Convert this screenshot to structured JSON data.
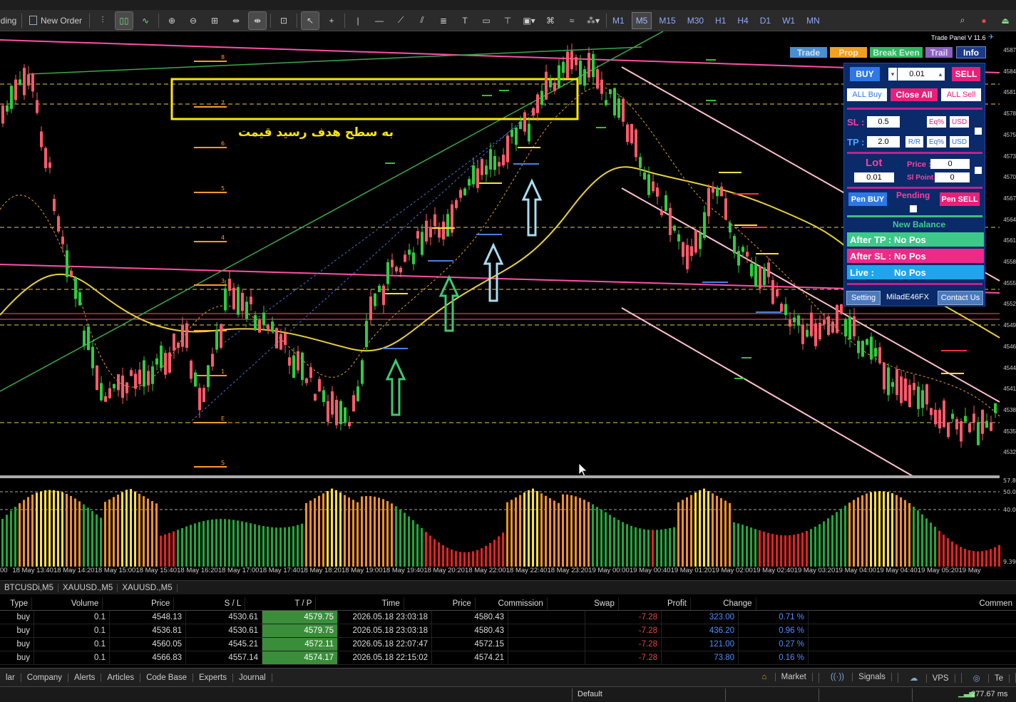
{
  "toolbar": {
    "left_cut_label": "ding",
    "new_order": "New Order",
    "timeframes": [
      "M1",
      "M5",
      "M15",
      "M30",
      "H1",
      "H4",
      "D1",
      "W1",
      "MN"
    ],
    "active_timeframe": "M5"
  },
  "panel": {
    "title": "Trade Panel V 11.6",
    "tabs": [
      "Trade",
      "Prop",
      "Break Even",
      "Trail",
      "Info"
    ],
    "buy": "BUY",
    "sell": "SELL",
    "lot_value": "0.01",
    "all_buy": "ALL Buy",
    "close_all": "Close All",
    "all_sell": "ALL Sell",
    "sl_label": "SL :",
    "sl_value": "0.5",
    "tp_label": "TP :",
    "tp_value": "2.0",
    "eq_pct": "Eq%",
    "usd": "USD",
    "rr": "R/R",
    "lot_label": "Lot",
    "lot_input": "0.01",
    "price_label": "Price :",
    "price_value": "0",
    "sl_point_label": "Sl Point :",
    "sl_point_value": "0",
    "pen_buy": "Pen BUY",
    "pending": "Pending",
    "pen_sell": "Pen SELL",
    "new_balance": "New Balance",
    "after_tp_label": "After TP :",
    "after_tp_value": "No Pos",
    "after_sl_label": "After SL :",
    "after_sl_value": "No Pos",
    "live_label": "Live :",
    "live_value": "No Pos",
    "setting": "Setting",
    "brand": "MiladE46FX",
    "contact": "Contact Us"
  },
  "annotation": "به سطح هدف رسید قیمت",
  "fib_labels": [
    "8",
    "7",
    "6",
    "5",
    "4",
    "3",
    "2",
    "1",
    "E",
    "S"
  ],
  "price_axis": [
    "4587",
    "4584",
    "4581",
    "4578",
    "4575",
    "4573",
    "4570",
    "4567",
    "4564",
    "4561",
    "4558",
    "4555",
    "4552",
    "4549",
    "4546",
    "4544",
    "4541",
    "4538",
    "4535",
    "4532"
  ],
  "indicator_axis": [
    "57.8",
    "50.0",
    "40.0",
    "9.39"
  ],
  "time_axis": [
    "00",
    "18 May 13:40",
    "18 May 14:20",
    "18 May 15:00",
    "18 May 15:40",
    "18 May 16:20",
    "18 May 17:00",
    "18 May 17:40",
    "18 May 18:20",
    "18 May 19:00",
    "18 May 19:40",
    "18 May 20:20",
    "18 May 22:00",
    "18 May 22:40",
    "18 May 23:20",
    "19 May 00:00",
    "19 May 00:40",
    "19 May 01:20",
    "19 May 02:00",
    "19 May 02:40",
    "19 May 03:20",
    "19 May 04:00",
    "19 May 04:40",
    "19 May 05:20",
    "19 May"
  ],
  "symbol_tabs": [
    "BTCUSDi,M5",
    "XAUUSD.,M5",
    "XAUUSD.,M5"
  ],
  "table": {
    "headers": [
      "Type",
      "Volume",
      "Price",
      "S / L",
      "T / P",
      "Time",
      "Price",
      "Commission",
      "Swap",
      "Profit",
      "Change",
      "Commen"
    ],
    "rows": [
      [
        "buy",
        "0.1",
        "4548.13",
        "4530.61",
        "4579.75",
        "2026.05.18 23:03:18",
        "4580.43",
        "",
        "-7.28",
        "323.00",
        "0.71 %"
      ],
      [
        "buy",
        "0.1",
        "4536.81",
        "4530.61",
        "4579.75",
        "2026.05.18 23:03:18",
        "4580.43",
        "",
        "-7.28",
        "436.20",
        "0.96 %"
      ],
      [
        "buy",
        "0.1",
        "4560.05",
        "4545.21",
        "4572.11",
        "2026.05.18 22:07:47",
        "4572.15",
        "",
        "-7.28",
        "121.00",
        "0.27 %"
      ],
      [
        "buy",
        "0.1",
        "4566.83",
        "4557.14",
        "4574.17",
        "2026.05.18 22:15:02",
        "4574.21",
        "",
        "-7.28",
        "73.80",
        "0.16 %"
      ]
    ]
  },
  "bottom_tabs": [
    "lar",
    "Company",
    "Alerts",
    "Articles",
    "Code Base",
    "Experts",
    "Journal"
  ],
  "bottom_right": [
    "Market",
    "Signals",
    "VPS",
    "Te"
  ],
  "status": {
    "profile": "Default",
    "ping": "277.67 ms"
  },
  "colors": {
    "bull": "#2ecc40",
    "bear": "#ff5a6a",
    "ma": "#e8d03a",
    "magenta": "#ff4fa8",
    "panel_bg": "#0a2a6a"
  }
}
